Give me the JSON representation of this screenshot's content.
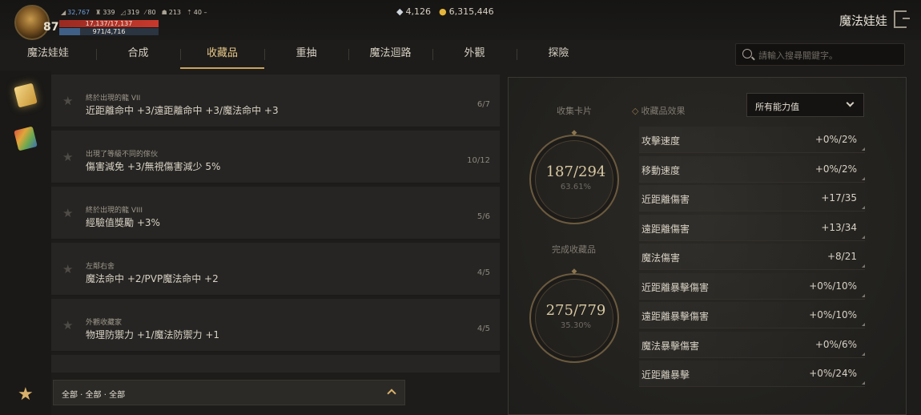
{
  "player": {
    "level": "87",
    "stats": [
      "32,767",
      "339",
      "319",
      "80",
      "213",
      "40"
    ],
    "hp": "17,137/17,137",
    "hp_fraction": 1.0,
    "mp": "971/4,716",
    "mp_fraction": 0.206
  },
  "currency": {
    "diamonds": "4,126",
    "gold": "6,315,446"
  },
  "window": {
    "title": "魔法娃娃"
  },
  "tabs": [
    {
      "label": "魔法娃娃"
    },
    {
      "label": "合成"
    },
    {
      "label": "收藏品"
    },
    {
      "label": "重抽"
    },
    {
      "label": "魔法迴路"
    },
    {
      "label": "外觀"
    },
    {
      "label": "探險"
    }
  ],
  "active_tab": "收藏品",
  "search": {
    "placeholder": "請輸入搜尋關鍵字。",
    "value": ""
  },
  "collections": [
    {
      "name": "終於出現的龍 VII",
      "effect": "近距離命中 +3/遠距離命中 +3/魔法命中 +3",
      "progress": "6/7"
    },
    {
      "name": "出現了等級不同的傢伙",
      "effect": "傷害減免 +3/無視傷害減少 5%",
      "progress": "10/12"
    },
    {
      "name": "終於出現的龍 VIII",
      "effect": "經驗值獎勵 +3%",
      "progress": "5/6"
    },
    {
      "name": "左鄰右舍",
      "effect": "魔法命中 +2/PVP魔法命中 +2",
      "progress": "4/5"
    },
    {
      "name": "外觀收藏家",
      "effect": "物理防禦力 +1/魔法防禦力 +1",
      "progress": "4/5"
    },
    {
      "name": "",
      "effect": "",
      "progress": ""
    }
  ],
  "filter": {
    "text": "全部 · 全部 · 全部"
  },
  "summary": {
    "cards_label": "收集卡片",
    "cards_value": "187/294",
    "cards_pct": "63.61%",
    "complete_label": "完成收藏品",
    "complete_value": "275/779",
    "complete_pct": "35.30%"
  },
  "effects": {
    "header": "收藏品效果",
    "dropdown": "所有能力值",
    "items": [
      {
        "label": "攻擊速度",
        "value": "+0%/2%"
      },
      {
        "label": "移動速度",
        "value": "+0%/2%"
      },
      {
        "label": "近距離傷害",
        "value": "+17/35"
      },
      {
        "label": "遠距離傷害",
        "value": "+13/34"
      },
      {
        "label": "魔法傷害",
        "value": "+8/21"
      },
      {
        "label": "近距離暴擊傷害",
        "value": "+0%/10%"
      },
      {
        "label": "遠距離暴擊傷害",
        "value": "+0%/10%"
      },
      {
        "label": "魔法暴擊傷害",
        "value": "+0%/6%"
      },
      {
        "label": "近距離暴擊",
        "value": "+0%/24%"
      }
    ]
  },
  "colors": {
    "accent": "#c9a35e",
    "hp": "#c6392c",
    "mp": "#3f5f86",
    "gold": "#e3b53b"
  }
}
